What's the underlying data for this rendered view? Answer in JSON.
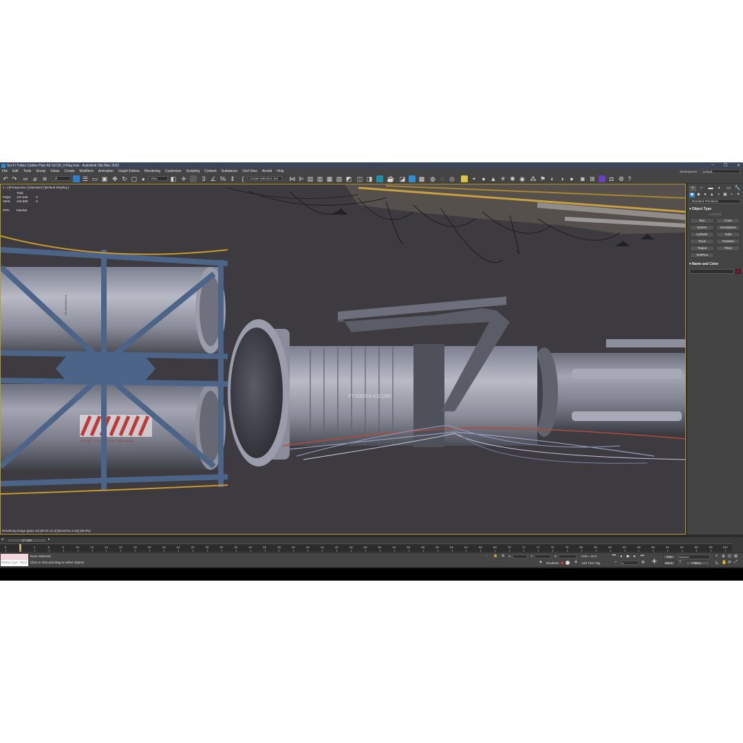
{
  "window": {
    "title": "Sci-Fi Tubes Cables Pipe Kit Vol 02_V-Ray.max - Autodesk 3ds Max 2022",
    "controls": [
      "–",
      "❐",
      "✕"
    ]
  },
  "menu": {
    "items": [
      "File",
      "Edit",
      "Tools",
      "Group",
      "Views",
      "Create",
      "Modifiers",
      "Animation",
      "Graph Editors",
      "Rendering",
      "Customize",
      "Scripting",
      "Content",
      "Substance",
      "Civil View",
      "Arnold",
      "Help"
    ],
    "workspace_label": "Workspaces:",
    "workspace_value": "Default"
  },
  "toolbar": {
    "selection_filter": "All",
    "reference_coord": "View",
    "named_selection": "Create Selection Set"
  },
  "viewport": {
    "label": "[ + ] [Perspective ] [Standard ] [Default Shading ]",
    "stats": {
      "header": "Total",
      "polys_label": "Polys:",
      "polys_value": "137,446",
      "polys_sel": "0",
      "verts_label": "Verts:",
      "verts_value": "142,669",
      "verts_sel": "0",
      "fps_label": "FPS:",
      "fps_value": "Inactive"
    },
    "render_status": "Rendering image (pass 22) [00:01:31.2] [00:03:54.3 est]    (46.6%)",
    "decal_text_1": "FT-000016-4321982",
    "decal_text_2": "STAND CLEAR FROM THIS AREA",
    "decal_text_3": "DE-8543354154"
  },
  "command_panel": {
    "tabs": [
      "+",
      "⌐",
      "▬",
      "◐",
      "▭",
      "🔧"
    ],
    "subtabs": [
      "◉",
      "◆",
      "●",
      "▲",
      "◑",
      "▣",
      "≈",
      "✦"
    ],
    "category": "Standard Primitives",
    "object_type_title": "Object Type",
    "autogrid": "AutoGrid",
    "primitives": [
      "Box",
      "Cone",
      "Sphere",
      "GeoSphere",
      "Cylinder",
      "Tube",
      "Torus",
      "Pyramid",
      "Teapot",
      "Plane",
      "TextPlus"
    ],
    "name_color_title": "Name and Color",
    "color": "#8a1030"
  },
  "timeline": {
    "slider": "0 / 100",
    "ticks": [
      0,
      2,
      4,
      6,
      8,
      10,
      12,
      14,
      16,
      18,
      20,
      22,
      24,
      26,
      28,
      30,
      32,
      34,
      36,
      38,
      40,
      42,
      44,
      46,
      48,
      50,
      52,
      54,
      56,
      58,
      60,
      62,
      64,
      66,
      68,
      70,
      72,
      74,
      76,
      78,
      80,
      82,
      84,
      86,
      88,
      90,
      92,
      94,
      96,
      98,
      100
    ]
  },
  "status": {
    "maxscript": "MAXScript Mini",
    "selection": "None Selected",
    "prompt": "Click or click-and-drag to select objects",
    "x_label": "X:",
    "y_label": "Y:",
    "z_label": "Z:",
    "grid": "Grid = 10.0",
    "disabled_label": "Disabled:",
    "add_time_tag": "Add Time Tag",
    "auto": "Auto",
    "selected": "Selected",
    "setk": "Set K.",
    "filters": "Filters...",
    "frame_value": "0"
  },
  "colors": {
    "viewport_bg": "#3d3b3f",
    "ui_panel": "#444444",
    "titlebar": "#3c4658",
    "active_border": "#b59a3a",
    "accent_blue": "#2f7fcf"
  }
}
